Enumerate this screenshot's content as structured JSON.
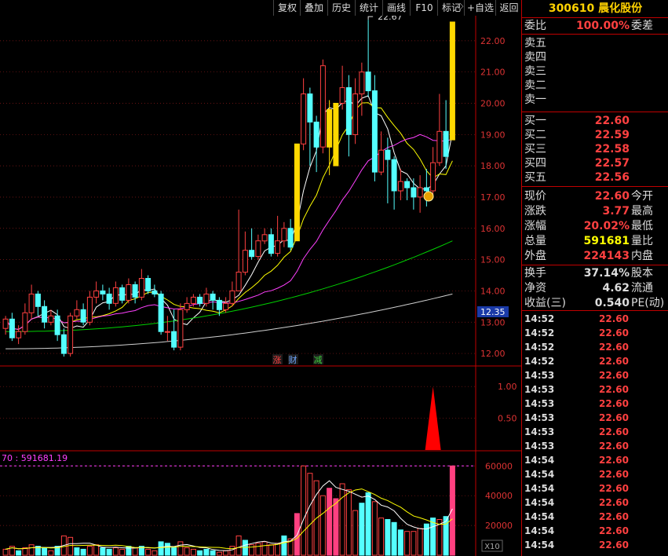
{
  "toolbar": {
    "buttons": [
      "复权",
      "叠加",
      "历史",
      "统计",
      "画线",
      "F10",
      "标记",
      "+自选",
      "返回"
    ],
    "corner_icon": "diamond-icon"
  },
  "right_panel": {
    "code": "300610",
    "name": "晨化股份",
    "commission": {
      "label": "委比",
      "value": "100.00%",
      "label2": "委差"
    },
    "sell": [
      {
        "label": "卖五"
      },
      {
        "label": "卖四"
      },
      {
        "label": "卖三"
      },
      {
        "label": "卖二"
      },
      {
        "label": "卖一"
      }
    ],
    "buy": [
      {
        "label": "买一",
        "value": "22.60"
      },
      {
        "label": "买二",
        "value": "22.59"
      },
      {
        "label": "买三",
        "value": "22.58"
      },
      {
        "label": "买四",
        "value": "22.57"
      },
      {
        "label": "买五",
        "value": "22.56"
      }
    ],
    "stats": [
      {
        "label": "现价",
        "value": "22.60",
        "label2": "今开",
        "color": "red"
      },
      {
        "label": "涨跌",
        "value": "3.77",
        "label2": "最高",
        "color": "red"
      },
      {
        "label": "涨幅",
        "value": "20.02%",
        "label2": "最低",
        "color": "red"
      },
      {
        "label": "总量",
        "value": "591681",
        "label2": "量比",
        "color": "yellow"
      },
      {
        "label": "外盘",
        "value": "224143",
        "label2": "内盘",
        "color": "red"
      }
    ],
    "stats2": [
      {
        "label": "换手",
        "value": "37.14%",
        "label2": "股本",
        "color": "white"
      },
      {
        "label": "净资",
        "value": "4.62",
        "label2": "流通",
        "color": "white"
      },
      {
        "label": "收益(三)",
        "value": "0.540",
        "label2": "PE(动)",
        "color": "white"
      }
    ],
    "ticks": [
      {
        "time": "14:52",
        "price": "22.60"
      },
      {
        "time": "14:52",
        "price": "22.60"
      },
      {
        "time": "14:52",
        "price": "22.60"
      },
      {
        "time": "14:52",
        "price": "22.60"
      },
      {
        "time": "14:53",
        "price": "22.60"
      },
      {
        "time": "14:53",
        "price": "22.60"
      },
      {
        "time": "14:53",
        "price": "22.60"
      },
      {
        "time": "14:53",
        "price": "22.60"
      },
      {
        "time": "14:53",
        "price": "22.60"
      },
      {
        "time": "14:53",
        "price": "22.60"
      },
      {
        "time": "14:54",
        "price": "22.60"
      },
      {
        "time": "14:54",
        "price": "22.60"
      },
      {
        "time": "14:54",
        "price": "22.60"
      },
      {
        "time": "14:54",
        "price": "22.60"
      },
      {
        "time": "14:54",
        "price": "22.60"
      },
      {
        "time": "14:54",
        "price": "22.60"
      },
      {
        "time": "14:54",
        "price": "22.60"
      }
    ]
  },
  "chart_data": [
    {
      "type": "candlestick",
      "ylim": [
        11.6,
        22.8
      ],
      "yticks": [
        "12.00",
        "13.00",
        "14.00",
        "15.00",
        "16.00",
        "17.00",
        "18.00",
        "19.00",
        "20.00",
        "21.00",
        "22.00"
      ],
      "current_price_label": "12.35",
      "high_annotation": "22.67",
      "markers": [
        {
          "text": "涨",
          "color": "#ff4040"
        },
        {
          "text": "财",
          "color": "#6fa8ff"
        },
        {
          "text": "减",
          "color": "#3ccf3c"
        }
      ],
      "colors": {
        "up": "#ff4040",
        "down": "#54ffff",
        "limit_up": "#ffd800",
        "ma5": "#ffffff",
        "ma10": "#ffff00",
        "ma20": "#ff40ff",
        "ma60": "#00d000",
        "ma120": "#cfcfcf"
      },
      "candles": [
        [
          12.8,
          13.1,
          13.2,
          12.6
        ],
        [
          13.1,
          12.5,
          13.3,
          12.4
        ],
        [
          12.5,
          12.7,
          12.9,
          12.3
        ],
        [
          12.7,
          13.3,
          13.6,
          12.6
        ],
        [
          13.3,
          13.9,
          14.2,
          13.1
        ],
        [
          13.9,
          13.5,
          14.0,
          13.2
        ],
        [
          13.5,
          13.0,
          13.7,
          12.8
        ],
        [
          13.0,
          13.2,
          13.4,
          12.9
        ],
        [
          13.2,
          12.6,
          13.4,
          12.4
        ],
        [
          12.6,
          12.0,
          12.8,
          11.9
        ],
        [
          12.0,
          13.2,
          13.3,
          11.9
        ],
        [
          13.2,
          13.4,
          13.7,
          13.1
        ],
        [
          13.4,
          13.0,
          13.6,
          12.9
        ],
        [
          13.0,
          13.8,
          14.0,
          12.9
        ],
        [
          13.8,
          14.0,
          14.3,
          13.6
        ],
        [
          14.0,
          13.9,
          14.2,
          13.7
        ],
        [
          13.9,
          13.6,
          14.1,
          13.4
        ],
        [
          13.6,
          14.1,
          14.3,
          13.5
        ],
        [
          14.1,
          13.7,
          14.2,
          13.6
        ],
        [
          13.7,
          14.2,
          14.4,
          13.6
        ],
        [
          14.2,
          13.8,
          14.3,
          13.6
        ],
        [
          13.8,
          14.4,
          14.7,
          13.7
        ],
        [
          14.4,
          14.0,
          14.5,
          13.9
        ],
        [
          14.0,
          13.9,
          14.2,
          13.8
        ],
        [
          13.9,
          12.7,
          14.0,
          12.6
        ],
        [
          12.7,
          12.7,
          13.2,
          12.4
        ],
        [
          12.7,
          12.2,
          13.4,
          12.1
        ],
        [
          12.2,
          13.4,
          13.6,
          12.1
        ],
        [
          13.4,
          13.6,
          13.8,
          13.3
        ],
        [
          13.6,
          13.8,
          13.9,
          13.5
        ],
        [
          13.8,
          13.6,
          13.9,
          13.5
        ],
        [
          13.6,
          13.9,
          14.1,
          13.5
        ],
        [
          13.9,
          13.7,
          14.0,
          13.4
        ],
        [
          13.7,
          13.4,
          13.8,
          13.2
        ],
        [
          13.4,
          13.6,
          13.8,
          13.3
        ],
        [
          13.6,
          14.0,
          14.3,
          13.5
        ],
        [
          14.0,
          14.6,
          16.6,
          14.0
        ],
        [
          14.6,
          15.3,
          15.9,
          14.5
        ],
        [
          15.3,
          15.1,
          16.0,
          15.0
        ],
        [
          15.1,
          15.6,
          15.8,
          15.0
        ],
        [
          15.6,
          15.8,
          16.0,
          15.5
        ],
        [
          15.8,
          15.2,
          16.0,
          15.1
        ],
        [
          15.2,
          15.6,
          16.4,
          15.1
        ],
        [
          15.6,
          16.0,
          16.2,
          15.4
        ],
        [
          16.0,
          15.4,
          16.3,
          15.3
        ],
        [
          15.6,
          18.7,
          18.7,
          15.6
        ],
        [
          18.7,
          20.3,
          20.8,
          18.5
        ],
        [
          20.3,
          19.4,
          20.5,
          18.0
        ],
        [
          19.4,
          18.6,
          19.6,
          17.8
        ],
        [
          18.6,
          21.2,
          21.4,
          18.4
        ],
        [
          18.6,
          19.8,
          20.1,
          17.7
        ],
        [
          18.0,
          20.0,
          20.0,
          18.0
        ],
        [
          20.0,
          20.5,
          21.2,
          19.8
        ],
        [
          20.5,
          19.0,
          20.9,
          18.3
        ],
        [
          19.0,
          20.3,
          20.8,
          18.7
        ],
        [
          20.3,
          21.0,
          21.3,
          19.6
        ],
        [
          21.0,
          20.4,
          22.67,
          20.2
        ],
        [
          20.4,
          17.8,
          20.9,
          17.5
        ],
        [
          17.8,
          18.5,
          19.1,
          17.7
        ],
        [
          18.5,
          18.2,
          18.9,
          16.8
        ],
        [
          18.2,
          17.2,
          18.3,
          16.6
        ],
        [
          17.2,
          17.5,
          17.9,
          16.9
        ],
        [
          17.5,
          17.3,
          17.6,
          16.9
        ],
        [
          17.3,
          17.0,
          17.6,
          16.6
        ],
        [
          17.0,
          17.3,
          17.7,
          16.5
        ],
        [
          17.3,
          17.2,
          17.9,
          16.7
        ],
        [
          17.2,
          18.1,
          18.6,
          17.0
        ],
        [
          18.1,
          19.1,
          20.3,
          18.0
        ],
        [
          19.1,
          18.3,
          20.1,
          17.9
        ],
        [
          18.83,
          22.6,
          22.6,
          18.83
        ]
      ],
      "limit_up_bars": [
        45,
        50,
        51,
        69
      ],
      "ma5_end": 18.9,
      "ma10_end": 18.4,
      "ma20_end": 18.7,
      "ma60_end": 15.6,
      "ma120_end": 13.9
    },
    {
      "type": "indicator",
      "ylim": [
        0,
        1.2
      ],
      "yticks": [
        "0.50",
        "1.00"
      ],
      "spike": {
        "bar": 66,
        "value": 1.0,
        "color": "#ff0000"
      }
    },
    {
      "type": "bar",
      "legend": "70 : 591681.19",
      "ylim": [
        0,
        67000
      ],
      "yticks": [
        "20000",
        "40000",
        "60000"
      ],
      "unit_label": "X10",
      "limit_line": 60000,
      "values": [
        4000,
        6000,
        3000,
        5000,
        7000,
        6000,
        5000,
        3000,
        6000,
        13000,
        12000,
        5000,
        4000,
        6000,
        7000,
        5000,
        4000,
        5000,
        4000,
        6000,
        5000,
        6000,
        4000,
        3000,
        9000,
        8000,
        5000,
        9000,
        5000,
        4000,
        3000,
        4000,
        3000,
        2000,
        3000,
        6000,
        13000,
        10000,
        7000,
        8000,
        9000,
        7000,
        8000,
        13000,
        11000,
        28000,
        60000,
        55000,
        50000,
        40000,
        45000,
        38000,
        48000,
        44000,
        30000,
        35000,
        42000,
        36000,
        25000,
        24000,
        22000,
        17000,
        16000,
        16000,
        18000,
        21000,
        25000,
        24000,
        26000,
        60000
      ],
      "directions": "uuduuddudu udduudduud uduuddduuu ddduuuuduu uuuduuuuuu uduuudduud dduuuddudu"
    }
  ]
}
